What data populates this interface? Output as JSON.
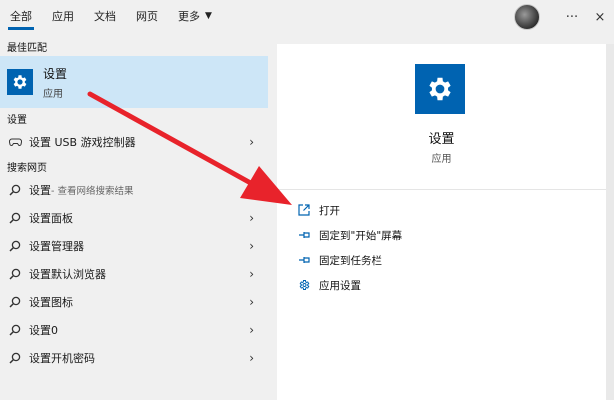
{
  "tabs": [
    {
      "label": "全部",
      "active": true
    },
    {
      "label": "应用"
    },
    {
      "label": "文档"
    },
    {
      "label": "网页"
    },
    {
      "label": "更多"
    }
  ],
  "topright": {
    "more_glyph": "···",
    "close_glyph": "×"
  },
  "left": {
    "best_match_label": "最佳匹配",
    "best": {
      "title": "设置",
      "subtitle": "应用"
    },
    "settings_label": "设置",
    "settings_items": [
      {
        "label": "设置 USB 游戏控制器"
      }
    ],
    "web_label": "搜索网页",
    "web_items": [
      {
        "label": "设置",
        "sub": " - 查看网络搜索结果"
      },
      {
        "label": "设置面板"
      },
      {
        "label": "设置管理器"
      },
      {
        "label": "设置默认浏览器"
      },
      {
        "label": "设置图标"
      },
      {
        "label": "设置0"
      },
      {
        "label": "设置开机密码"
      }
    ]
  },
  "right": {
    "title": "设置",
    "subtitle": "应用",
    "actions": [
      {
        "label": "打开",
        "icon": "open-icon"
      },
      {
        "label": "固定到\"开始\"屏幕",
        "icon": "pin-icon"
      },
      {
        "label": "固定到任务栏",
        "icon": "pin-icon"
      },
      {
        "label": "应用设置",
        "icon": "gear-icon"
      }
    ]
  },
  "colors": {
    "accent": "#0063b1",
    "selected": "#cde6f7",
    "annotation": "#e8232b"
  }
}
